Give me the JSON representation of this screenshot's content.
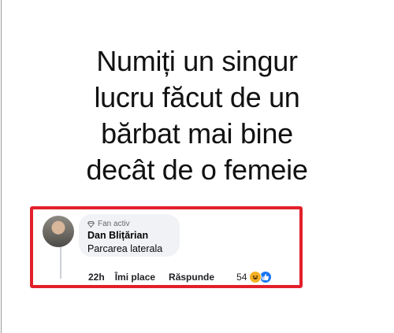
{
  "post": {
    "headline_lines": [
      "Numiți un singur",
      "lucru făcut de un",
      "bărbat mai bine",
      "decât de o femeie"
    ]
  },
  "comment": {
    "badge": "Fan activ",
    "author": "Dan Blițărian",
    "text": "Parcarea laterala",
    "time": "22h",
    "like_label": "Îmi place",
    "reply_label": "Răspunde",
    "reaction_count": "54",
    "reaction_icons": [
      "haha-icon",
      "like-icon"
    ]
  },
  "colors": {
    "highlight_border": "#e2202a",
    "bubble_bg": "#f0f2f5",
    "like_blue": "#1877f2",
    "haha_yellow": "#f7b125"
  }
}
